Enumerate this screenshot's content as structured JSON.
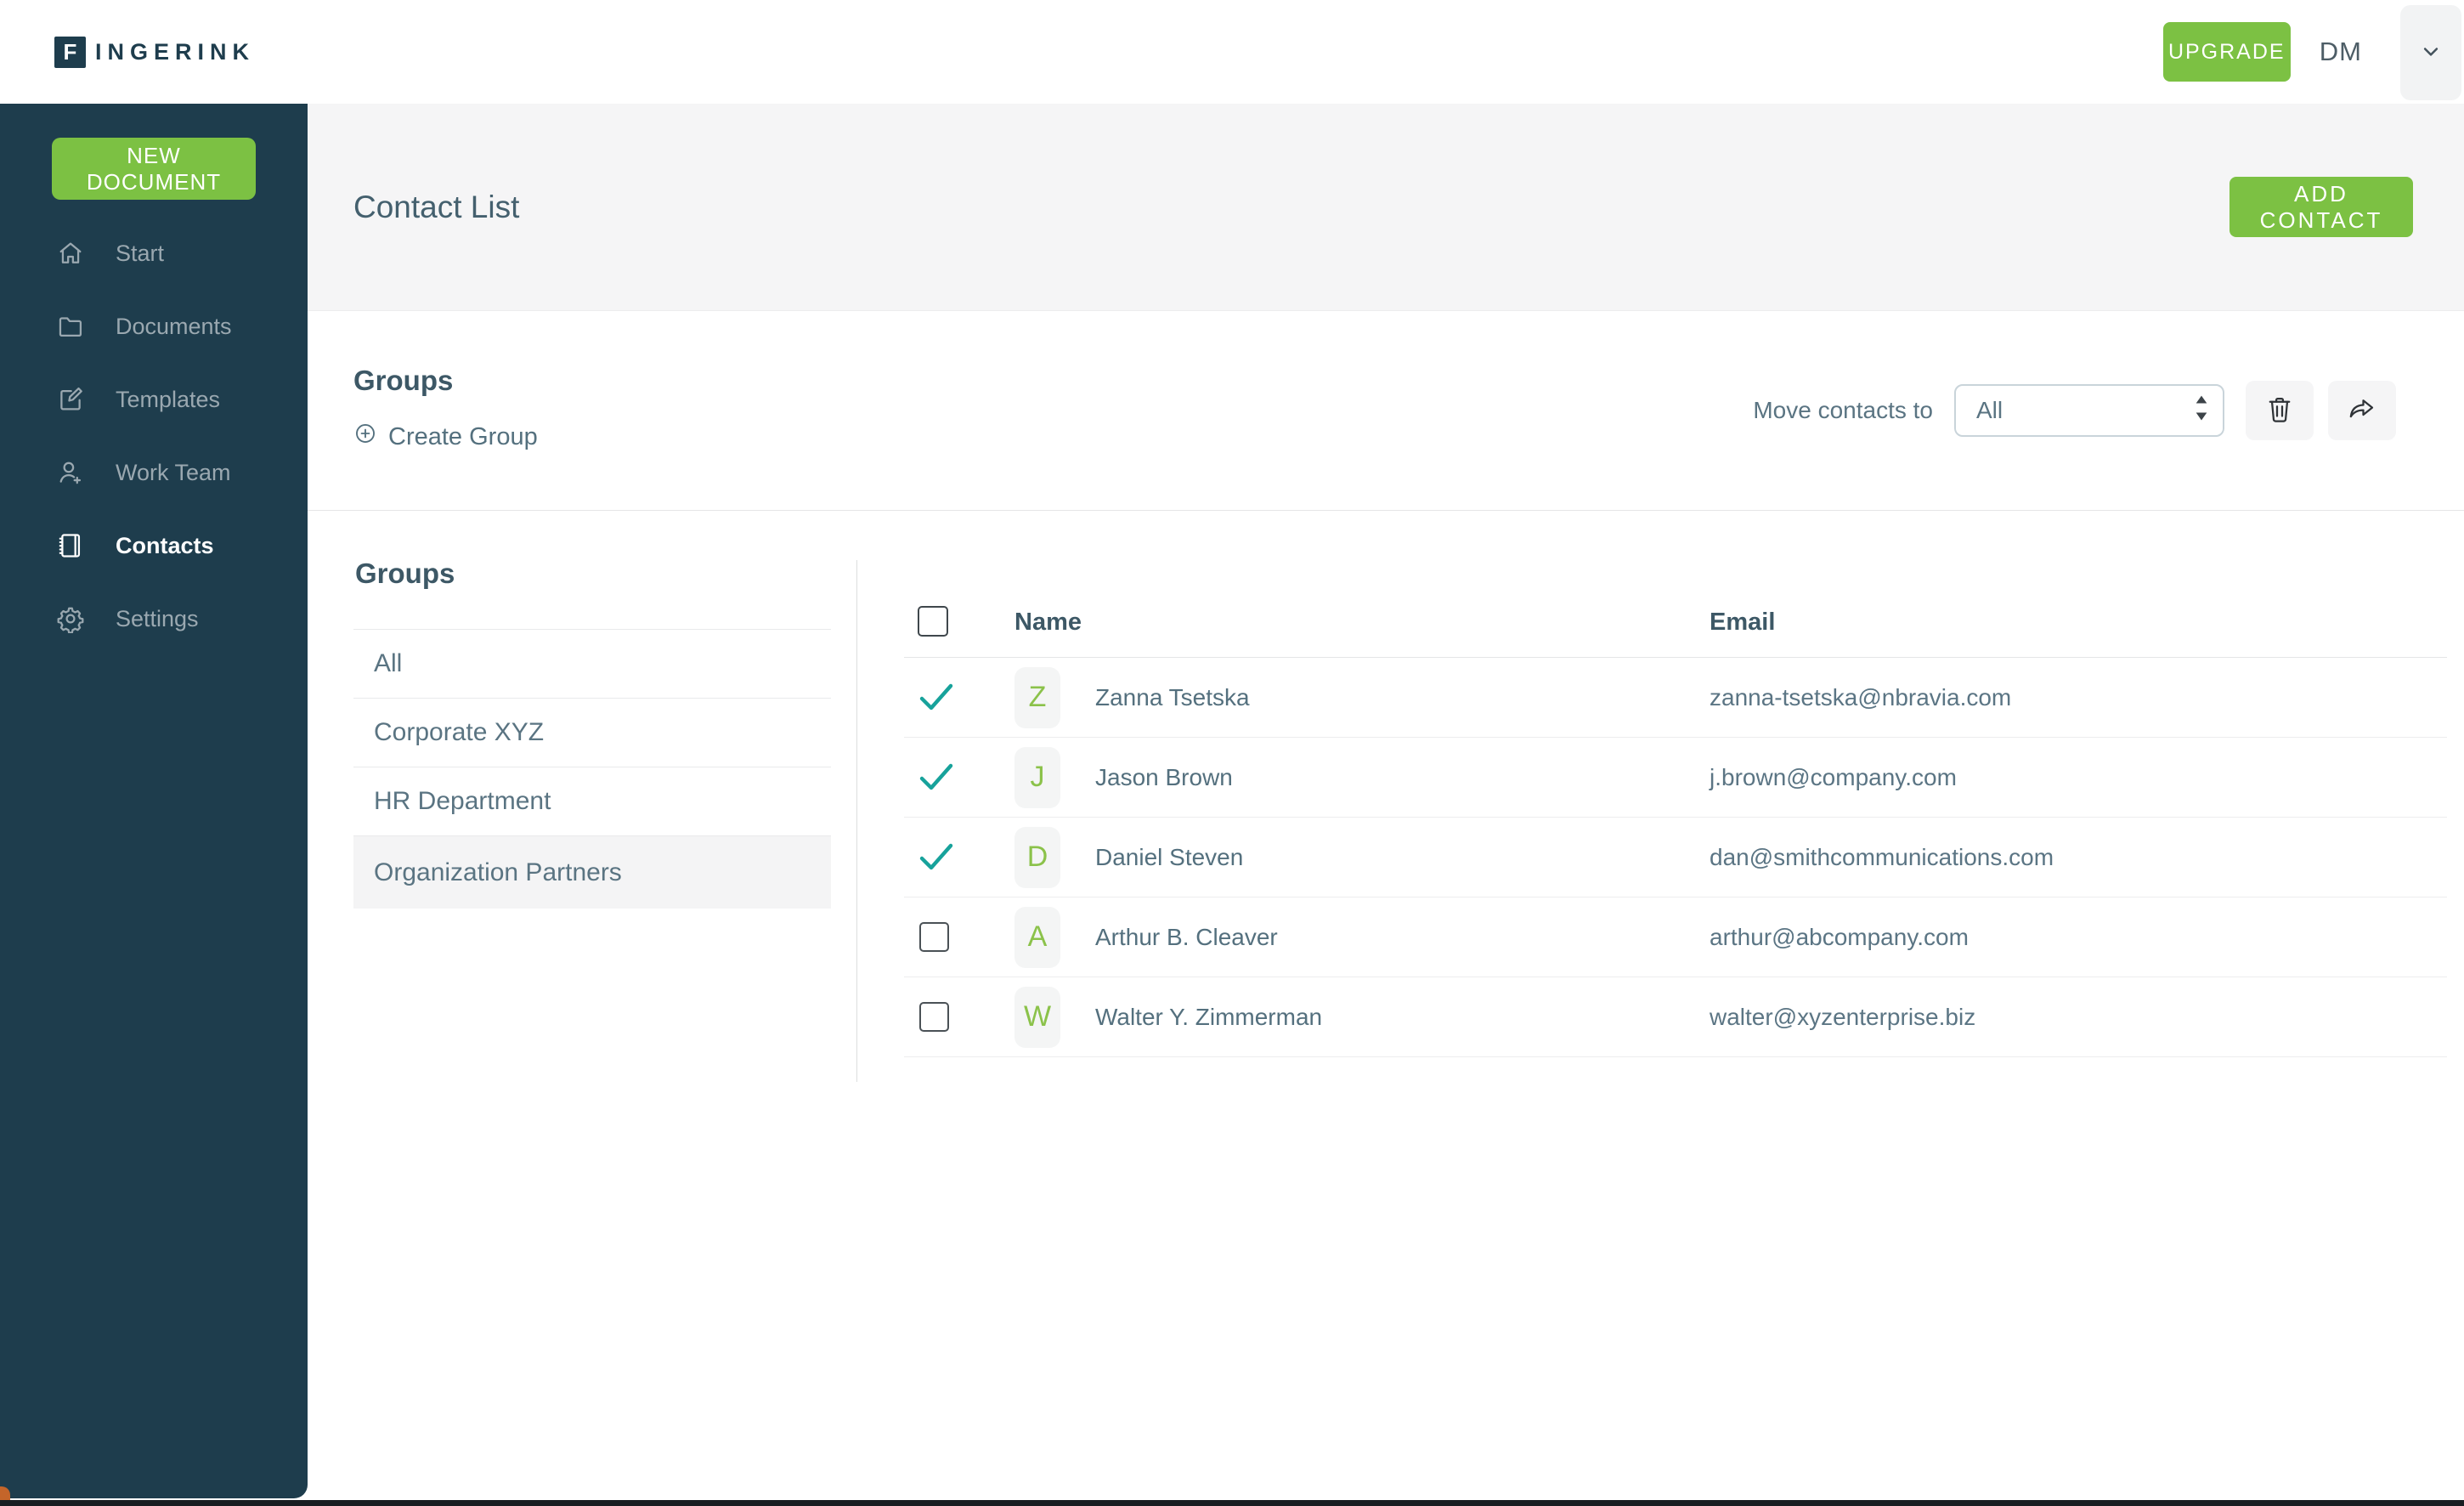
{
  "topbar": {
    "logo_letter": "F",
    "logo_text": "INGERINK",
    "upgrade_label": "UPGRADE",
    "user_initials": "DM"
  },
  "sidebar": {
    "new_document_label": "NEW DOCUMENT",
    "items": [
      {
        "label": "Start",
        "icon": "home-icon",
        "active": false
      },
      {
        "label": "Documents",
        "icon": "folder-icon",
        "active": false
      },
      {
        "label": "Templates",
        "icon": "edit-icon",
        "active": false
      },
      {
        "label": "Work Team",
        "icon": "user-plus-icon",
        "active": false
      },
      {
        "label": "Contacts",
        "icon": "address-book-icon",
        "active": true
      },
      {
        "label": "Settings",
        "icon": "gear-icon",
        "active": false
      }
    ]
  },
  "page": {
    "title": "Contact List",
    "add_contact_label": "ADD CONTACT"
  },
  "groups_toolbar": {
    "title": "Groups",
    "create_group_label": "Create Group",
    "move_contacts_label": "Move contacts to",
    "move_target_value": "All"
  },
  "groups_panel": {
    "title": "Groups",
    "items": [
      "All",
      "Corporate XYZ",
      "HR Department",
      "Organization Partners"
    ],
    "selected": "Organization Partners"
  },
  "contacts_table": {
    "columns": [
      "Name",
      "Email"
    ],
    "rows": [
      {
        "initial": "Z",
        "name": "Zanna Tsetska",
        "email": "zanna-tsetska@nbravia.com",
        "selected": true
      },
      {
        "initial": "J",
        "name": "Jason Brown",
        "email": "j.brown@company.com",
        "selected": true
      },
      {
        "initial": "D",
        "name": "Daniel Steven",
        "email": "dan@smithcommunications.com",
        "selected": true
      },
      {
        "initial": "A",
        "name": "Arthur B. Cleaver",
        "email": "arthur@abcompany.com",
        "selected": false
      },
      {
        "initial": "W",
        "name": "Walter Y. Zimmerman",
        "email": "walter@xyzenterprise.biz",
        "selected": false
      }
    ]
  },
  "colors": {
    "accent_green": "#7cc143",
    "avatar_letter_green": "#8bc24a",
    "check_teal": "#17a29b",
    "sidebar_bg": "#1e3d4d",
    "band_gray": "#f5f5f6",
    "text_slate": "#44606e",
    "corner_orange": "#c4652a"
  }
}
